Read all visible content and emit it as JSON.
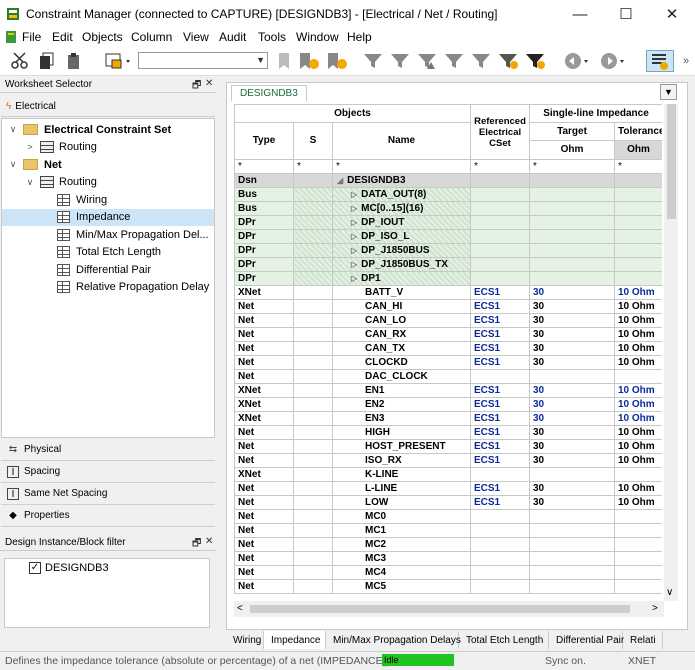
{
  "window": {
    "title": "Constraint Manager (connected to CAPTURE) [DESIGNDB3] - [Electrical / Net / Routing]",
    "minimize": "—",
    "maximize": "☐",
    "close": "✕"
  },
  "menu": [
    "File",
    "Edit",
    "Objects",
    "Column",
    "View",
    "Audit",
    "Tools",
    "Window",
    "Help"
  ],
  "toolbar": {
    "combo_value": ""
  },
  "worksheet_selector": {
    "title": "Worksheet Selector",
    "pin": "🗗",
    "close": "✕",
    "electrical_label": "Electrical",
    "tree": [
      {
        "label": "Electrical Constraint Set",
        "level": 0,
        "type": "folder",
        "expander": "∨",
        "bold": true
      },
      {
        "label": "Routing",
        "level": 1,
        "type": "gridb",
        "expander": ">"
      },
      {
        "label": "Net",
        "level": 0,
        "type": "folder",
        "expander": "∨",
        "bold": true
      },
      {
        "label": "Routing",
        "level": 1,
        "type": "gridb",
        "expander": "∨"
      },
      {
        "label": "Wiring",
        "level": 2,
        "type": "grid"
      },
      {
        "label": "Impedance",
        "level": 2,
        "type": "grid",
        "selected": true
      },
      {
        "label": "Min/Max Propagation Del...",
        "level": 2,
        "type": "grid"
      },
      {
        "label": "Total Etch Length",
        "level": 2,
        "type": "grid"
      },
      {
        "label": "Differential Pair",
        "level": 2,
        "type": "grid"
      },
      {
        "label": "Relative Propagation Delay",
        "level": 2,
        "type": "grid"
      }
    ],
    "categories": [
      "Physical",
      "Spacing",
      "Same Net Spacing",
      "Properties"
    ]
  },
  "filter_panel": {
    "title": "Design Instance/Block filter",
    "item": "DESIGNDB3",
    "checked": true
  },
  "design_tab": "DESIGNDB3",
  "grid": {
    "header": {
      "objects": "Objects",
      "type": "Type",
      "s": "S",
      "name": "Name",
      "cset": "Referenced Electrical CSet",
      "impedance": "Single-line Impedance",
      "target": "Target",
      "tolerance": "Tolerance",
      "unit_target": "Ohm",
      "unit_tol": "Ohm"
    },
    "filter_row": [
      "*",
      "*",
      "*",
      "*",
      "*",
      "*"
    ],
    "rows": [
      {
        "type": "Dsn",
        "name": "DESIGNDB3",
        "cset": "",
        "target": "",
        "tol": "",
        "style": "gray",
        "arrow": "◢"
      },
      {
        "type": "Bus",
        "name": "DATA_OUT(8)",
        "cset": "",
        "target": "",
        "tol": "",
        "style": "green",
        "arrow": "▷"
      },
      {
        "type": "Bus",
        "name": "MC[0..15](16)",
        "cset": "",
        "target": "",
        "tol": "",
        "style": "green",
        "arrow": "▷"
      },
      {
        "type": "DPr",
        "name": "DP_IOUT",
        "cset": "",
        "target": "",
        "tol": "",
        "style": "green",
        "arrow": "▷"
      },
      {
        "type": "DPr",
        "name": "DP_ISO_L",
        "cset": "",
        "target": "",
        "tol": "",
        "style": "green",
        "arrow": "▷"
      },
      {
        "type": "DPr",
        "name": "DP_J1850BUS",
        "cset": "",
        "target": "",
        "tol": "",
        "style": "green",
        "arrow": "▷"
      },
      {
        "type": "DPr",
        "name": "DP_J1850BUS_TX",
        "cset": "",
        "target": "",
        "tol": "",
        "style": "green",
        "arrow": "▷"
      },
      {
        "type": "DPr",
        "name": "DP1",
        "cset": "",
        "target": "",
        "tol": "",
        "style": "green",
        "arrow": "▷"
      },
      {
        "type": "XNet",
        "name": "BATT_V",
        "cset": "ECS1",
        "target": "30",
        "tol": "10 Ohm",
        "style": "white",
        "blue": true
      },
      {
        "type": "Net",
        "name": "CAN_HI",
        "cset": "ECS1",
        "target": "30",
        "tol": "10 Ohm",
        "style": "white"
      },
      {
        "type": "Net",
        "name": "CAN_LO",
        "cset": "ECS1",
        "target": "30",
        "tol": "10 Ohm",
        "style": "white"
      },
      {
        "type": "Net",
        "name": "CAN_RX",
        "cset": "ECS1",
        "target": "30",
        "tol": "10 Ohm",
        "style": "white"
      },
      {
        "type": "Net",
        "name": "CAN_TX",
        "cset": "ECS1",
        "target": "30",
        "tol": "10 Ohm",
        "style": "white"
      },
      {
        "type": "Net",
        "name": "CLOCKD",
        "cset": "ECS1",
        "target": "30",
        "tol": "10 Ohm",
        "style": "white"
      },
      {
        "type": "Net",
        "name": "DAC_CLOCK",
        "cset": "",
        "target": "",
        "tol": "",
        "style": "white"
      },
      {
        "type": "XNet",
        "name": "EN1",
        "cset": "ECS1",
        "target": "30",
        "tol": "10 Ohm",
        "style": "white",
        "blue": true
      },
      {
        "type": "XNet",
        "name": "EN2",
        "cset": "ECS1",
        "target": "30",
        "tol": "10 Ohm",
        "style": "white",
        "blue": true
      },
      {
        "type": "XNet",
        "name": "EN3",
        "cset": "ECS1",
        "target": "30",
        "tol": "10 Ohm",
        "style": "white",
        "blue": true
      },
      {
        "type": "Net",
        "name": "HIGH",
        "cset": "ECS1",
        "target": "30",
        "tol": "10 Ohm",
        "style": "white"
      },
      {
        "type": "Net",
        "name": "HOST_PRESENT",
        "cset": "ECS1",
        "target": "30",
        "tol": "10 Ohm",
        "style": "white"
      },
      {
        "type": "Net",
        "name": "ISO_RX",
        "cset": "ECS1",
        "target": "30",
        "tol": "10 Ohm",
        "style": "white"
      },
      {
        "type": "XNet",
        "name": "K-LINE",
        "cset": "",
        "target": "",
        "tol": "",
        "style": "white"
      },
      {
        "type": "Net",
        "name": "L-LINE",
        "cset": "ECS1",
        "target": "30",
        "tol": "10 Ohm",
        "style": "white"
      },
      {
        "type": "Net",
        "name": "LOW",
        "cset": "ECS1",
        "target": "30",
        "tol": "10 Ohm",
        "style": "white"
      },
      {
        "type": "Net",
        "name": "MC0",
        "cset": "",
        "target": "",
        "tol": "",
        "style": "white"
      },
      {
        "type": "Net",
        "name": "MC1",
        "cset": "",
        "target": "",
        "tol": "",
        "style": "white"
      },
      {
        "type": "Net",
        "name": "MC2",
        "cset": "",
        "target": "",
        "tol": "",
        "style": "white"
      },
      {
        "type": "Net",
        "name": "MC3",
        "cset": "",
        "target": "",
        "tol": "",
        "style": "white"
      },
      {
        "type": "Net",
        "name": "MC4",
        "cset": "",
        "target": "",
        "tol": "",
        "style": "white"
      },
      {
        "type": "Net",
        "name": "MC5",
        "cset": "",
        "target": "",
        "tol": "",
        "style": "white"
      }
    ]
  },
  "bottom_tabs": [
    "Wiring",
    "Impedance",
    "Min/Max Propagation Delays",
    "Total Etch Length",
    "Differential Pair",
    "Relati"
  ],
  "active_bottom_tab": "Impedance",
  "status": {
    "message": "Defines the impedance tolerance (absolute or percentage) of a net (IMPEDANCE_I",
    "idle": "Idle",
    "sync": "Sync on.",
    "mode": "XNET"
  },
  "colors": {
    "accent_green": "#21c321",
    "blue_values": "#0a2a9a",
    "row_green": "#e4f2e4",
    "selection": "#cce4f7"
  }
}
